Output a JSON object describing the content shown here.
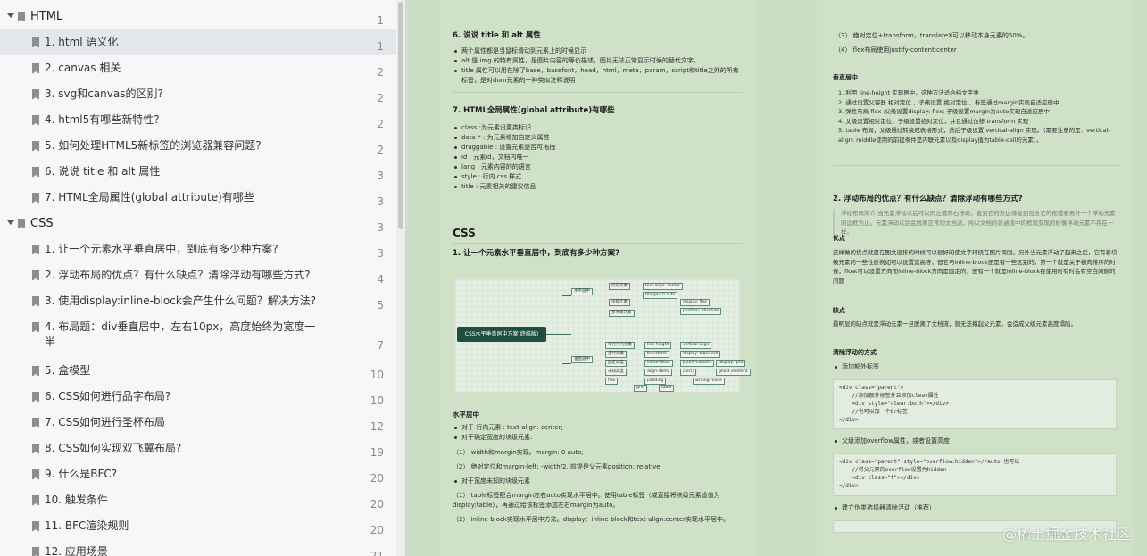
{
  "outline": {
    "items": [
      {
        "label": "HTML",
        "page": "1",
        "level": 0,
        "expanded": true
      },
      {
        "label": "1. html 语义化",
        "page": "1",
        "level": 1,
        "selected": true
      },
      {
        "label": "2. canvas 相关",
        "page": "2",
        "level": 1
      },
      {
        "label": "3. svg和canvas的区别?",
        "page": "2",
        "level": 1
      },
      {
        "label": "4. html5有哪些新特性?",
        "page": "2",
        "level": 1
      },
      {
        "label": "5. 如何处理HTML5新标签的浏览器兼容问题?",
        "page": "2",
        "level": 1
      },
      {
        "label": "6. 说说 title 和 alt 属性",
        "page": "3",
        "level": 1
      },
      {
        "label": "7. HTML全局属性(global attribute)有哪些",
        "page": "3",
        "level": 1
      },
      {
        "label": "CSS",
        "page": "3",
        "level": 0,
        "expanded": true
      },
      {
        "label": "1. 让一个元素水平垂直居中，到底有多少种方案?",
        "page": "3",
        "level": 1
      },
      {
        "label": "2. 浮动布局的优点？有什么缺点？清除浮动有哪些方式?",
        "page": "4",
        "level": 1
      },
      {
        "label": "3. 使用display:inline-block会产生什么问题？解决方法?",
        "page": "5",
        "level": 1
      },
      {
        "label": "4. 布局题：div垂直居中，左右10px，高度始终为宽度一半",
        "page": "7",
        "level": 1
      },
      {
        "label": "5. 盒模型",
        "page": "10",
        "level": 1
      },
      {
        "label": "6. CSS如何进行品字布局?",
        "page": "10",
        "level": 1
      },
      {
        "label": "7. CSS如何进行圣杯布局",
        "page": "12",
        "level": 1
      },
      {
        "label": "8. CSS如何实现双飞翼布局?",
        "page": "19",
        "level": 1
      },
      {
        "label": "9. 什么是BFC?",
        "page": "20",
        "level": 1
      },
      {
        "label": "10. 触发条件",
        "page": "20",
        "level": 1
      },
      {
        "label": "11. BFC渲染规则",
        "page": "20",
        "level": 1
      },
      {
        "label": "12. 应用场景",
        "page": "21",
        "level": 1
      }
    ]
  },
  "doc_left": {
    "s6_title": "6. 说说 title 和 alt 属性",
    "s6_items": [
      "两个属性都是当鼠标滑动到元素上的时候显示",
      "alt 是 img 的特有属性，是图片内容的等价描述，图片无法正常显示时候的替代文字。",
      "title 属性可以用在除了base，basefont，head，html，meta，param，script和title之外的所有标签，是对dom元素的一种类似注释说明"
    ],
    "s7_title": "7. HTML全局属性(global attribute)有哪些",
    "s7_items": [
      "class :为元素设置类标识",
      "data-* : 为元素增加自定义属性",
      "draggable : 设置元素是否可拖拽",
      "id : 元素id，文档内唯一",
      "lang : 元素内容的的语言",
      "style : 行内 css 样式",
      "title : 元素相关的建议信息"
    ],
    "css_title": "CSS",
    "css1_title": "1. 让一个元素水平垂直居中，到底有多少种方案?",
    "mindmap_root": "CSS水平垂直居中方案(终结版)",
    "mm_nodes": [
      "水平居中",
      "行内元素",
      "块级元素",
      "多块级元素",
      "垂直居中",
      "单行行内元素",
      "多行元素",
      "固定高度",
      "未知高度",
      "flex",
      "grid",
      "table",
      "text-align: center",
      "margin: 0 auto",
      "display: flex",
      "position: absolute",
      "line-height",
      "vertical-align",
      "transform",
      "display: table-cell",
      "inline-block",
      "justify-content",
      "align-items",
      "calc()",
      "padding",
      "writing-mode",
      "ghost element",
      "display: grid"
    ],
    "hc_title": "水平居中",
    "hc_items": [
      "对于 行内元素 : text-align: center;",
      "对于确定宽度的块级元素:"
    ],
    "hc_p1": "（1） width和margin实现。margin: 0 auto;",
    "hc_p2": "（2） 绝对定位和margin-left: -width/2, 前提是父元素position: relative",
    "hc_item3": "对于宽度未知的块级元素",
    "hc_p3": "（1） table标签配合margin左右auto实现水平居中。使用table标签（或直接将块级元素设值为display:table），再通过给该标签添加左右margin为auto。",
    "hc_p4": "（2） inline-block实现水平居中方法。display：inline-block和text-align:center实现水平居中。"
  },
  "doc_right": {
    "top_p1": "（3） 绝对定位+transform，translateX可以移动本身元素的50%。",
    "top_p2": "（4） flex布局使用justify-content:center",
    "vc_title": "垂直居中",
    "vc_items": [
      "1. 利用 line-height 实现居中，这种方法适合纯文字类",
      "2. 通过设置父容器 相对定位 ，子级设置 绝对定位 ，标签通过margin实现自适应居中",
      "3. 弹性布局 flex :父级设置display: flex; 子级设置margin为auto实现自适应居中",
      "4. 父级设置相对定位，子级设置绝对定位，并且通过位移 transform 实现",
      "5. table 布局，父级通过转换成表格形式，然后子级设置 vertical-align 实现。（需要注意的是：vertical-align: middle使用的前提条件是内联元素以及display值为table-cell的元素）。"
    ],
    "s2_title": "2. 浮动布局的优点？有什么缺点？清除浮动有哪些方式?",
    "s2_quote": "浮动布局简介:当元素浮动以后可以向左或向右移动，直到它的外边缘碰到包含它的框或者另外一个浮动元素的边框为止。元素浮动以后会脱离正常的文档流，所以文档的普通流中的框就变现的好像浮动元素不存在一样。",
    "adv_title": "优点",
    "adv_text": "这样做的优点就是在图文混排的时候可以很好的使文字环绕在图片周围。另外当元素浮动了起来之后，它有着块级元素的一些性质例如可以设置宽高等，但它与inline-block还是有一些区别的，第一个就是关于横向排序的时候，float可以设置方向而inline-block方向是固定的；还有一个就是inline-block在使用时有时会有空白间隙的问题",
    "dis_title": "缺点",
    "dis_text": "最明显的缺点就是浮动元素一旦脱离了文档流，就无法撑起父元素，会造成父级元素高度塌陷。",
    "clr_title": "清除浮动的方式",
    "clr_item1": "添加额外标签",
    "code1": [
      "<div class=\"parent\">",
      "    //添加额外标签并且添加clear属性",
      "    <div style=\"clear:both\"></div>",
      "    //也可以加一个br标签",
      "</div>"
    ],
    "clr_item2": "父级添加overflow属性，或者设置高度",
    "code2": [
      "<div class=\"parent\" style=\"overflow:hidden\">//auto 也可以",
      "    //将父元素的overflow设置为hidden",
      "    <div class=\"f\"></div>",
      "</div>"
    ],
    "clr_item3": "建立伪类选择器清除浮动（推荐）"
  },
  "watermark": "@稀土掘金技术社区"
}
